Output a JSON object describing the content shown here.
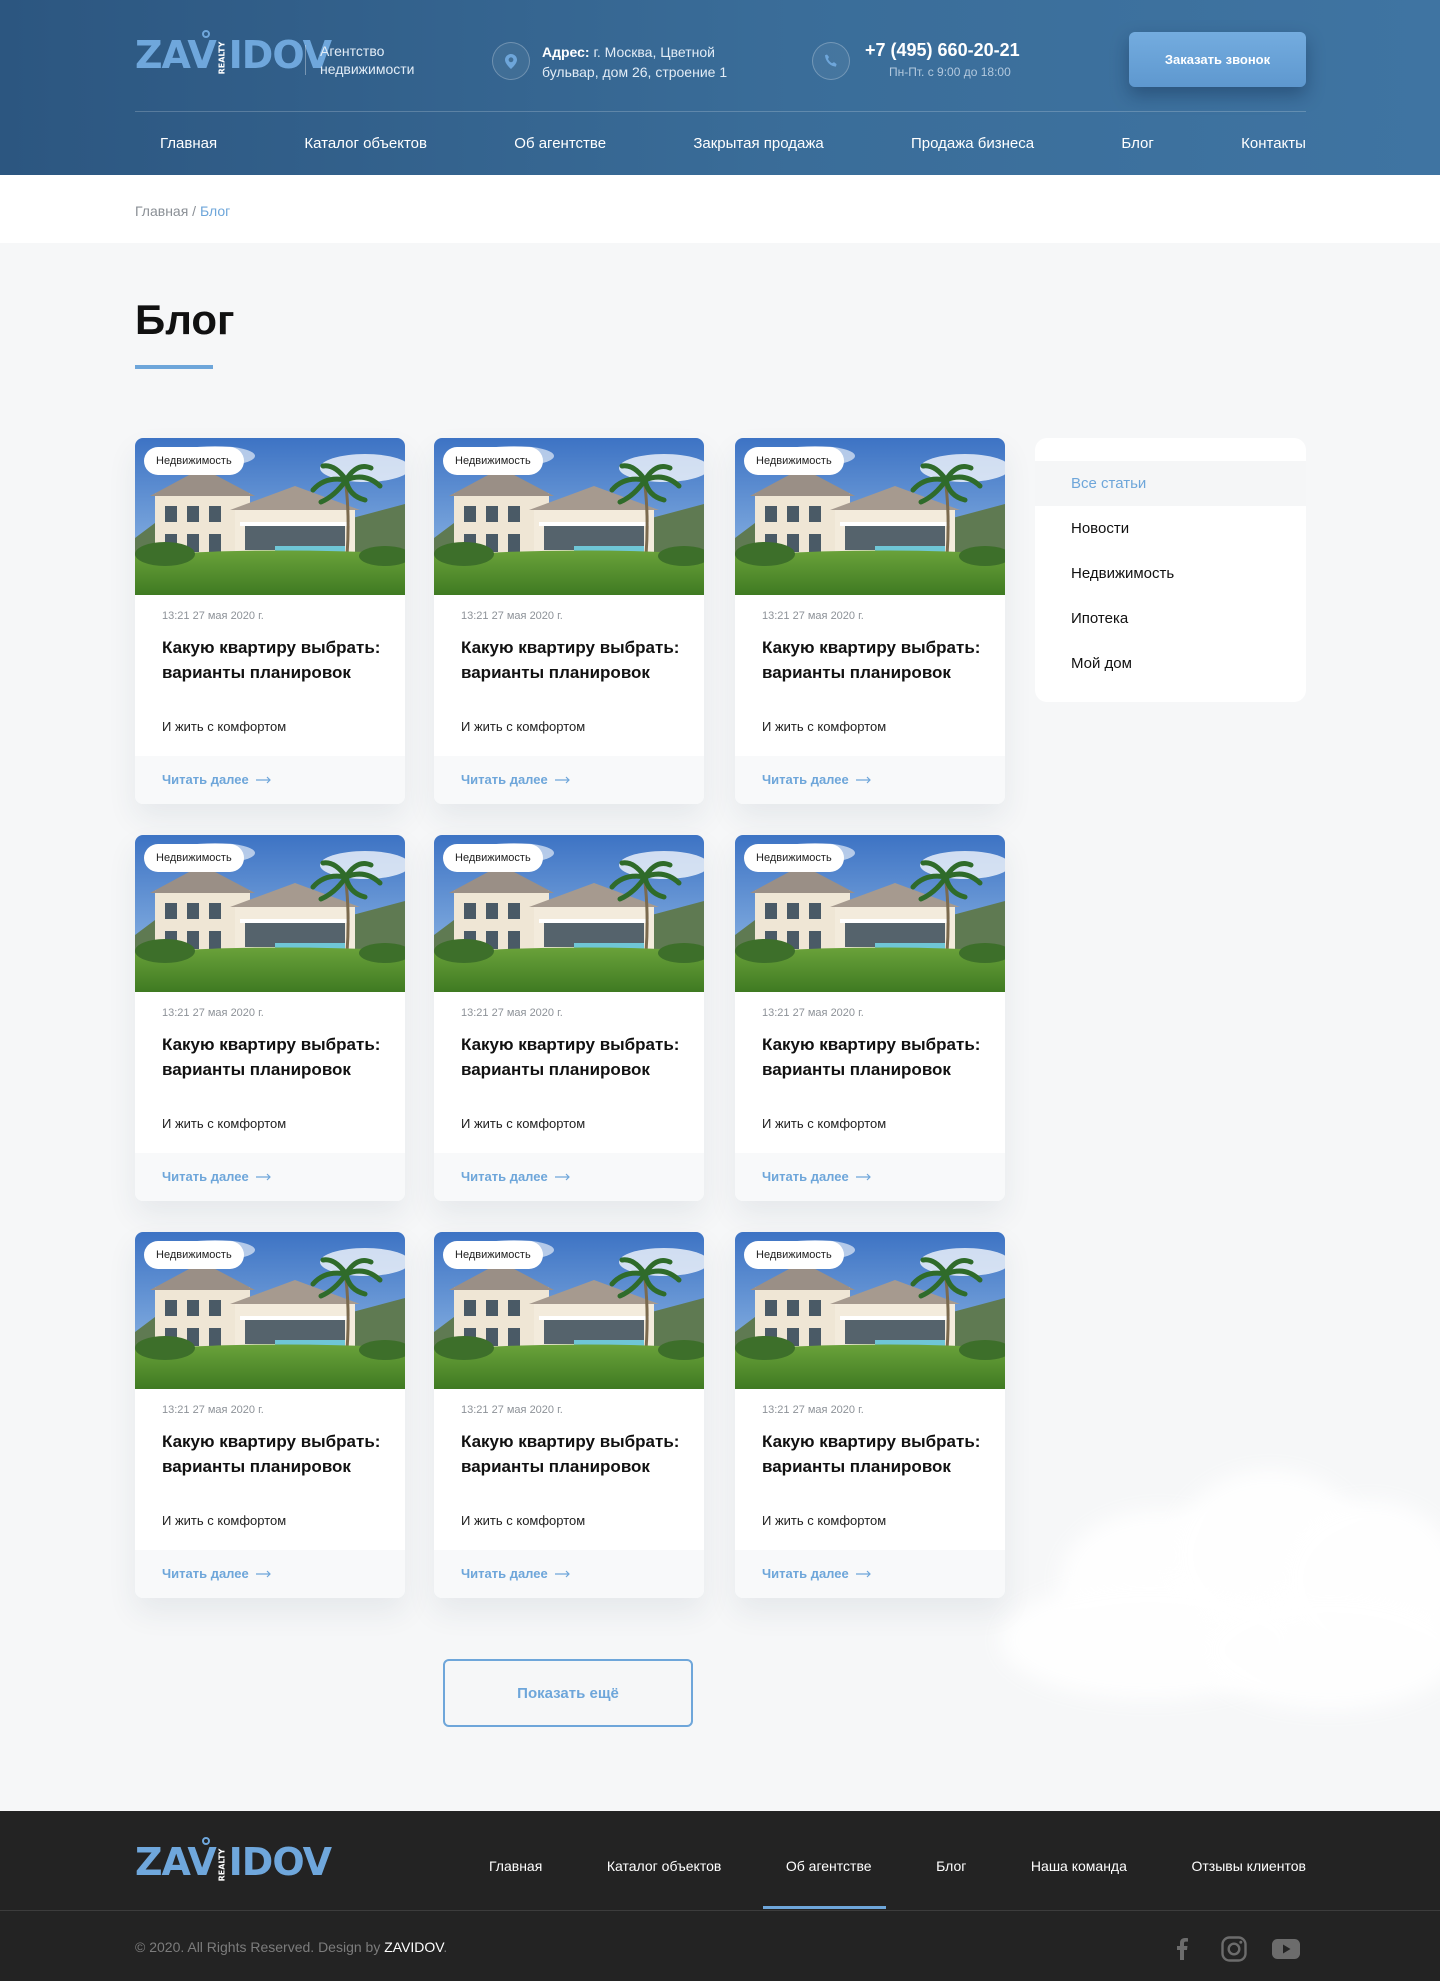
{
  "header": {
    "logo": "ZAVIDOV",
    "logo_sub": "REALTY",
    "agency": "Агентство недвижимости",
    "address_label": "Адрес:",
    "address_text": " г. Москва, Цветной бульвар, дом 26, строение 1",
    "phone": "+7 (495) 660-20-21",
    "hours": "Пн-Пт. с  9:00 до 18:00",
    "call_button": "Заказать звонок",
    "nav": [
      "Главная",
      "Каталог объектов",
      "Об агентстве",
      "Закрытая продажа",
      "Продажа бизнеса",
      "Блог",
      "Контакты"
    ]
  },
  "breadcrumb": {
    "home": "Главная",
    "separator": " / ",
    "current": "Блог"
  },
  "page_title": "Блог",
  "cards": [
    {
      "tag": "Недвижимость",
      "date": "13:21 27 мая 2020 г.",
      "title": "Какую квартиру выбрать: варианты планировок",
      "subtitle": "И жить с комфортом",
      "link": "Читать далее"
    },
    {
      "tag": "Недвижимость",
      "date": "13:21 27 мая 2020 г.",
      "title": "Какую квартиру выбрать: варианты планировок",
      "subtitle": "И жить с комфортом",
      "link": "Читать далее"
    },
    {
      "tag": "Недвижимость",
      "date": "13:21 27 мая 2020 г.",
      "title": "Какую квартиру выбрать: варианты планировок",
      "subtitle": "И жить с комфортом",
      "link": "Читать далее"
    },
    {
      "tag": "Недвижимость",
      "date": "13:21 27 мая 2020 г.",
      "title": "Какую квартиру выбрать: варианты планировок",
      "subtitle": "И жить с комфортом",
      "link": "Читать далее"
    },
    {
      "tag": "Недвижимость",
      "date": "13:21 27 мая 2020 г.",
      "title": "Какую квартиру выбрать: варианты планировок",
      "subtitle": "И жить с комфортом",
      "link": "Читать далее"
    },
    {
      "tag": "Недвижимость",
      "date": "13:21 27 мая 2020 г.",
      "title": "Какую квартиру выбрать: варианты планировок",
      "subtitle": "И жить с комфортом",
      "link": "Читать далее"
    },
    {
      "tag": "Недвижимость",
      "date": "13:21 27 мая 2020 г.",
      "title": "Какую квартиру выбрать: варианты планировок",
      "subtitle": "И жить с комфортом",
      "link": "Читать далее"
    },
    {
      "tag": "Недвижимость",
      "date": "13:21 27 мая 2020 г.",
      "title": "Какую квартиру выбрать: варианты планировок",
      "subtitle": "И жить с комфортом",
      "link": "Читать далее"
    },
    {
      "tag": "Недвижимость",
      "date": "13:21 27 мая 2020 г.",
      "title": "Какую квартиру выбрать: варианты планировок",
      "subtitle": "И жить с комфортом",
      "link": "Читать далее"
    }
  ],
  "sidebar": {
    "active_index": 0,
    "items": [
      "Все статьи",
      "Новости",
      "Недвижимость",
      "Ипотека",
      "Мой дом"
    ]
  },
  "show_more": "Показать ещё",
  "footer": {
    "nav": [
      "Главная",
      "Каталог объектов",
      "Об агентстве",
      "Блог",
      "Наша команда",
      "Отзывы клиентов"
    ],
    "active_nav": "Об агентстве",
    "copyright": "© 2020. All Rights Reserved. Design by ",
    "brand": "ZAVIDOV",
    "dot": ".",
    "socials": [
      "facebook-icon",
      "instagram-icon",
      "youtube-icon"
    ]
  },
  "colors": {
    "accent": "#6ea6da",
    "header_bg": "#2c5680",
    "footer_bg": "#232323",
    "page_bg": "#f6f7f8"
  }
}
